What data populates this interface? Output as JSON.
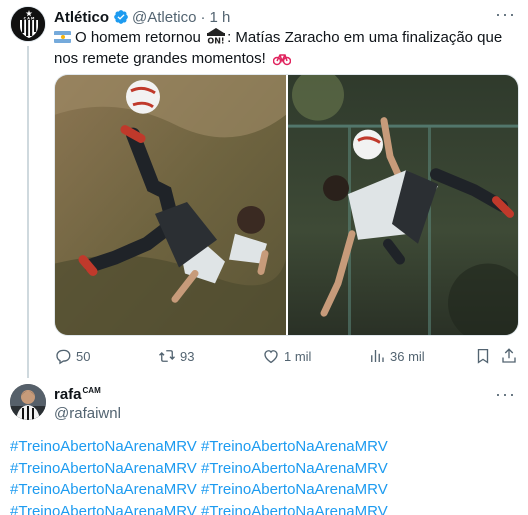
{
  "tweet": {
    "author_name": "Atlético",
    "author_handle": "@Atletico",
    "separator": "·",
    "time": "1 h",
    "text_part1": "O homem retornou",
    "text_part2": ": Matías Zaracho em uma finalização que nos remete grandes momentos!",
    "emojis": [
      "argentina-flag",
      "on-arrow",
      "bicycle"
    ],
    "media": [
      {
        "description": "player-bicycle-kick-left"
      },
      {
        "description": "player-bicycle-kick-right"
      }
    ],
    "actions": {
      "replies": "50",
      "retweets": "93",
      "likes": "1 mil",
      "views": "36 mil"
    }
  },
  "reply": {
    "author_name": "rafa",
    "author_badge": "CAM",
    "author_handle": "@rafaiwnl",
    "hashtags": [
      "#TreinoAbertoNaArenaMRV",
      "#TreinoAbertoNaArenaMRV",
      "#TreinoAbertoNaArenaMRV",
      "#TreinoAbertoNaArenaMRV",
      "#TreinoAbertoNaArenaMRV",
      "#TreinoAbertoNaArenaMRV",
      "#TreinoAbertoNaArenaMRV",
      "#TreinoAbertoNaArenaMRV"
    ]
  },
  "colors": {
    "link": "#1d9bf0",
    "secondary_text": "#536471",
    "verified": "#1d9bf0"
  }
}
